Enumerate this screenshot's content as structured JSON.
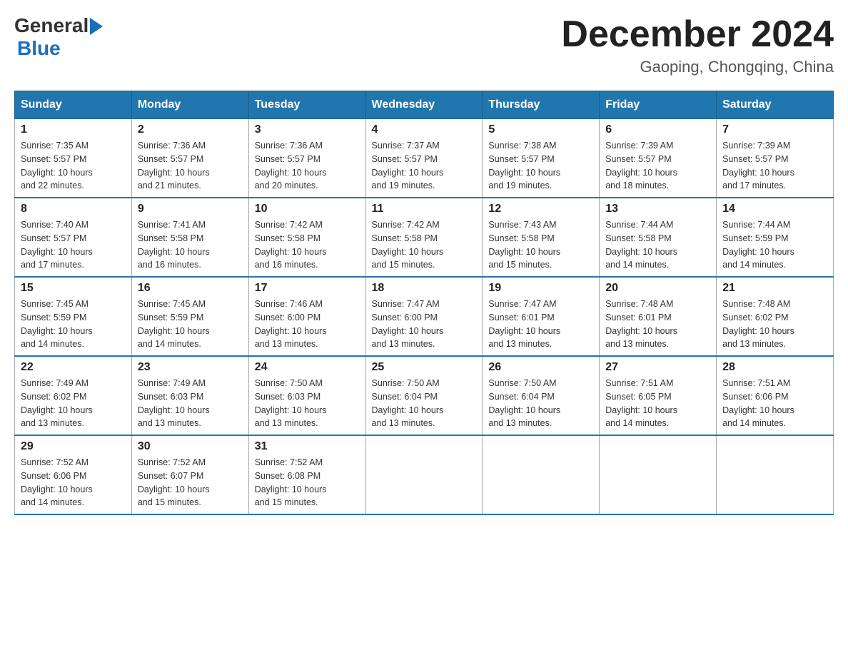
{
  "logo": {
    "general": "General",
    "arrow": "",
    "blue": "Blue"
  },
  "title": {
    "month": "December 2024",
    "location": "Gaoping, Chongqing, China"
  },
  "weekdays": [
    "Sunday",
    "Monday",
    "Tuesday",
    "Wednesday",
    "Thursday",
    "Friday",
    "Saturday"
  ],
  "weeks": [
    [
      {
        "day": "1",
        "sunrise": "7:35 AM",
        "sunset": "5:57 PM",
        "daylight": "10 hours and 22 minutes."
      },
      {
        "day": "2",
        "sunrise": "7:36 AM",
        "sunset": "5:57 PM",
        "daylight": "10 hours and 21 minutes."
      },
      {
        "day": "3",
        "sunrise": "7:36 AM",
        "sunset": "5:57 PM",
        "daylight": "10 hours and 20 minutes."
      },
      {
        "day": "4",
        "sunrise": "7:37 AM",
        "sunset": "5:57 PM",
        "daylight": "10 hours and 19 minutes."
      },
      {
        "day": "5",
        "sunrise": "7:38 AM",
        "sunset": "5:57 PM",
        "daylight": "10 hours and 19 minutes."
      },
      {
        "day": "6",
        "sunrise": "7:39 AM",
        "sunset": "5:57 PM",
        "daylight": "10 hours and 18 minutes."
      },
      {
        "day": "7",
        "sunrise": "7:39 AM",
        "sunset": "5:57 PM",
        "daylight": "10 hours and 17 minutes."
      }
    ],
    [
      {
        "day": "8",
        "sunrise": "7:40 AM",
        "sunset": "5:57 PM",
        "daylight": "10 hours and 17 minutes."
      },
      {
        "day": "9",
        "sunrise": "7:41 AM",
        "sunset": "5:58 PM",
        "daylight": "10 hours and 16 minutes."
      },
      {
        "day": "10",
        "sunrise": "7:42 AM",
        "sunset": "5:58 PM",
        "daylight": "10 hours and 16 minutes."
      },
      {
        "day": "11",
        "sunrise": "7:42 AM",
        "sunset": "5:58 PM",
        "daylight": "10 hours and 15 minutes."
      },
      {
        "day": "12",
        "sunrise": "7:43 AM",
        "sunset": "5:58 PM",
        "daylight": "10 hours and 15 minutes."
      },
      {
        "day": "13",
        "sunrise": "7:44 AM",
        "sunset": "5:58 PM",
        "daylight": "10 hours and 14 minutes."
      },
      {
        "day": "14",
        "sunrise": "7:44 AM",
        "sunset": "5:59 PM",
        "daylight": "10 hours and 14 minutes."
      }
    ],
    [
      {
        "day": "15",
        "sunrise": "7:45 AM",
        "sunset": "5:59 PM",
        "daylight": "10 hours and 14 minutes."
      },
      {
        "day": "16",
        "sunrise": "7:45 AM",
        "sunset": "5:59 PM",
        "daylight": "10 hours and 14 minutes."
      },
      {
        "day": "17",
        "sunrise": "7:46 AM",
        "sunset": "6:00 PM",
        "daylight": "10 hours and 13 minutes."
      },
      {
        "day": "18",
        "sunrise": "7:47 AM",
        "sunset": "6:00 PM",
        "daylight": "10 hours and 13 minutes."
      },
      {
        "day": "19",
        "sunrise": "7:47 AM",
        "sunset": "6:01 PM",
        "daylight": "10 hours and 13 minutes."
      },
      {
        "day": "20",
        "sunrise": "7:48 AM",
        "sunset": "6:01 PM",
        "daylight": "10 hours and 13 minutes."
      },
      {
        "day": "21",
        "sunrise": "7:48 AM",
        "sunset": "6:02 PM",
        "daylight": "10 hours and 13 minutes."
      }
    ],
    [
      {
        "day": "22",
        "sunrise": "7:49 AM",
        "sunset": "6:02 PM",
        "daylight": "10 hours and 13 minutes."
      },
      {
        "day": "23",
        "sunrise": "7:49 AM",
        "sunset": "6:03 PM",
        "daylight": "10 hours and 13 minutes."
      },
      {
        "day": "24",
        "sunrise": "7:50 AM",
        "sunset": "6:03 PM",
        "daylight": "10 hours and 13 minutes."
      },
      {
        "day": "25",
        "sunrise": "7:50 AM",
        "sunset": "6:04 PM",
        "daylight": "10 hours and 13 minutes."
      },
      {
        "day": "26",
        "sunrise": "7:50 AM",
        "sunset": "6:04 PM",
        "daylight": "10 hours and 13 minutes."
      },
      {
        "day": "27",
        "sunrise": "7:51 AM",
        "sunset": "6:05 PM",
        "daylight": "10 hours and 14 minutes."
      },
      {
        "day": "28",
        "sunrise": "7:51 AM",
        "sunset": "6:06 PM",
        "daylight": "10 hours and 14 minutes."
      }
    ],
    [
      {
        "day": "29",
        "sunrise": "7:52 AM",
        "sunset": "6:06 PM",
        "daylight": "10 hours and 14 minutes."
      },
      {
        "day": "30",
        "sunrise": "7:52 AM",
        "sunset": "6:07 PM",
        "daylight": "10 hours and 15 minutes."
      },
      {
        "day": "31",
        "sunrise": "7:52 AM",
        "sunset": "6:08 PM",
        "daylight": "10 hours and 15 minutes."
      },
      null,
      null,
      null,
      null
    ]
  ],
  "labels": {
    "sunrise": "Sunrise:",
    "sunset": "Sunset:",
    "daylight": "Daylight:"
  }
}
